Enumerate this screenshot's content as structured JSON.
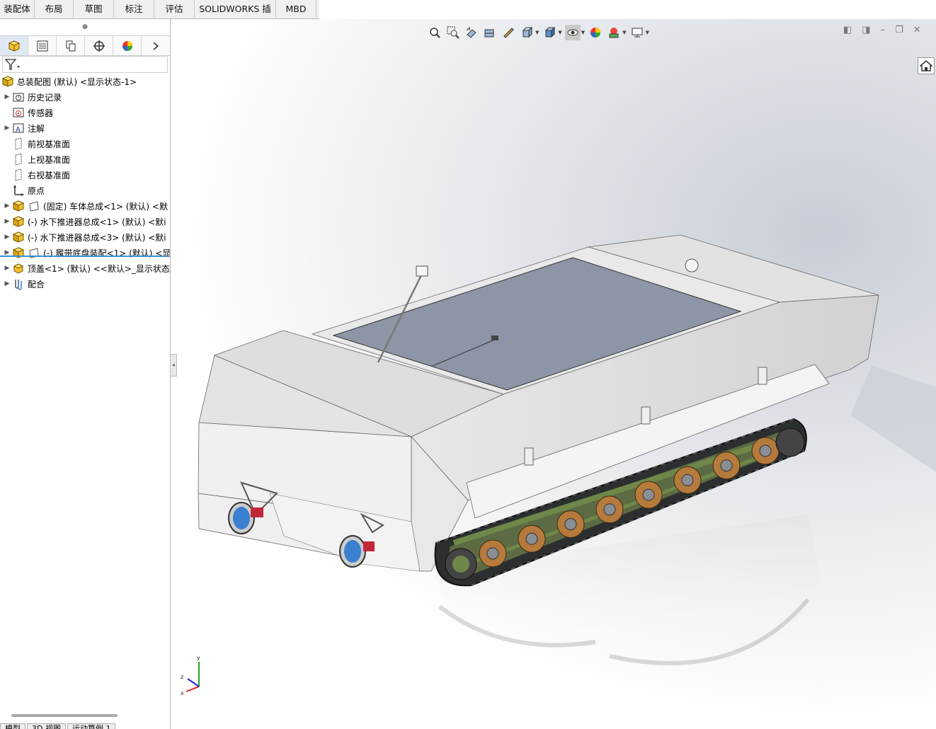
{
  "command_tabs": [
    "装配体",
    "布局",
    "草图",
    "标注",
    "评估",
    "SOLIDWORKS 插件",
    "MBD"
  ],
  "manager_tabs": [
    "feature-manager",
    "property-manager",
    "configuration-manager",
    "dimxpert-manager",
    "display-manager"
  ],
  "tree": {
    "root": "总装配图 (默认) <显示状态-1>",
    "items": [
      {
        "label": "历史记录",
        "expand": true,
        "icon": "history-folder-icon"
      },
      {
        "label": "传感器",
        "expand": false,
        "icon": "sensor-icon"
      },
      {
        "label": "注解",
        "expand": true,
        "icon": "annotation-icon"
      },
      {
        "label": "前视基准面",
        "expand": false,
        "icon": "plane-icon"
      },
      {
        "label": "上视基准面",
        "expand": false,
        "icon": "plane-icon"
      },
      {
        "label": "右视基准面",
        "expand": false,
        "icon": "plane-icon"
      },
      {
        "label": "原点",
        "expand": false,
        "icon": "origin-icon"
      },
      {
        "label": "(固定) 车体总成<1> (默认) <默",
        "expand": true,
        "icon": "subassembly-icon",
        "subicon": true
      },
      {
        "label": "(-) 水下推进器总成<1> (默认) <默i",
        "expand": true,
        "icon": "subassembly-icon"
      },
      {
        "label": "(-) 水下推进器总成<3> (默认) <默i",
        "expand": true,
        "icon": "subassembly-icon"
      },
      {
        "label": "(-) 履带底盘装配<1> (默认) <显",
        "expand": true,
        "icon": "subassembly-icon",
        "subicon": true
      },
      {
        "label": "顶盖<1> (默认) <<默认>_显示状态",
        "expand": true,
        "icon": "part-icon"
      },
      {
        "label": "配合",
        "expand": true,
        "icon": "mates-icon"
      }
    ]
  },
  "bottom_tabs": [
    "模型",
    "3D 视图",
    "运动算例 1"
  ],
  "heads_up_icons": [
    "zoom-to-fit-icon",
    "zoom-to-area-icon",
    "previous-view-icon",
    "section-view-icon",
    "dynamic-annotation-icon",
    "view-orientation-icon",
    "display-style-icon",
    "hide-show-icon",
    "edit-appearance-icon",
    "apply-scene-icon",
    "view-settings-icon"
  ],
  "triad": {
    "x": "x",
    "y": "y",
    "z": "z"
  },
  "colors": {
    "accent": "#3b8fd0",
    "selection_tab": "#dfe9f5",
    "hull": "#e6e6e6",
    "glass": "#8e95a6",
    "track": "#2c2f30",
    "wheel": "#b57a3c",
    "frame": "#6f8748"
  }
}
